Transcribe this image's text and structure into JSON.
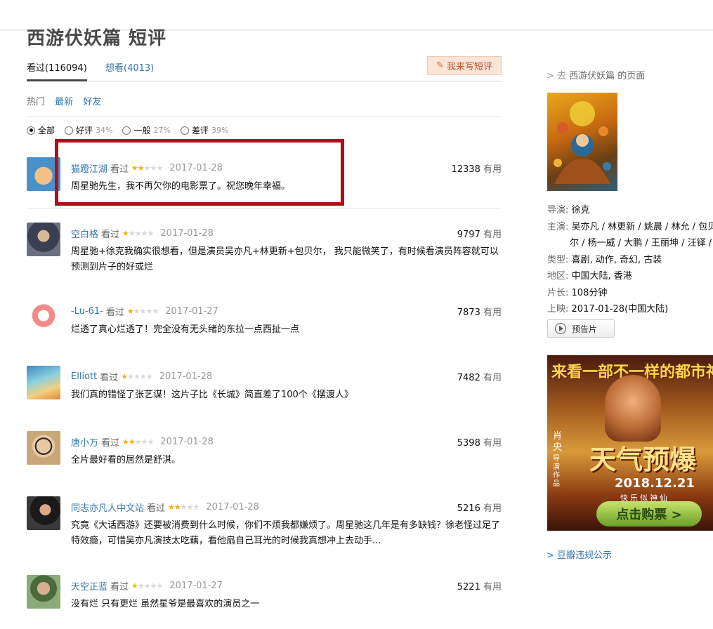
{
  "page_title": "西游伏妖篇 短评",
  "tabs": {
    "watched": "看过(116094)",
    "want": "想看(4013)"
  },
  "write_button": "我来写短评",
  "sort": {
    "hot": "热门",
    "latest": "最新",
    "friends": "好友"
  },
  "filters": [
    {
      "label": "全部",
      "pct": "",
      "selected": true
    },
    {
      "label": "好评",
      "pct": "34%",
      "selected": false
    },
    {
      "label": "一般",
      "pct": "27%",
      "selected": false
    },
    {
      "label": "差评",
      "pct": "39%",
      "selected": false
    }
  ],
  "comments": [
    {
      "user": "猫蹬江湖",
      "saw": "看过",
      "stars": 2,
      "date": "2017-01-28",
      "useful_num": "12338",
      "useful_label": "有用",
      "text": "周星驰先生，我不再欠你的电影票了。祝您晚年幸福。",
      "avatar_color": "#4a90c8"
    },
    {
      "user": "空白格",
      "saw": "看过",
      "stars": 1,
      "date": "2017-01-28",
      "useful_num": "9797",
      "useful_label": "有用",
      "text": "周星驰+徐克我确实很想看，但是演员吴亦凡+林更新+包贝尔， 我只能微笑了，有时候看演员阵容就可以预测到片子的好或烂",
      "avatar_color": "#5a6070"
    },
    {
      "user": "-Lu-61-",
      "saw": "看过",
      "stars": 1,
      "date": "2017-01-27",
      "useful_num": "7873",
      "useful_label": "有用",
      "text": "烂透了真心烂透了！完全没有无头绪的东拉一点西扯一点",
      "avatar_color": "#f2a0a0"
    },
    {
      "user": "Elliott",
      "saw": "看过",
      "stars": 1,
      "date": "2017-01-28",
      "useful_num": "7482",
      "useful_label": "有用",
      "text": "我们真的错怪了张艺谋！这片子比《长城》简直差了100个《摆渡人》",
      "avatar_color": "#7ac0d8"
    },
    {
      "user": "唐小万",
      "saw": "看过",
      "stars": 2,
      "date": "2017-01-28",
      "useful_num": "5398",
      "useful_label": "有用",
      "text": "全片最好看的居然是舒淇。",
      "avatar_color": "#d8b890"
    },
    {
      "user": "同志亦凡人中文站",
      "saw": "看过",
      "stars": 2,
      "date": "2017-01-28",
      "useful_num": "5216",
      "useful_label": "有用",
      "text": "究竟《大话西游》还要被消费到什么时候，你们不烦我都嫌烦了。周星驰这几年是有多缺钱？徐老怪过足了特效瘾，可惜吴亦凡演技太吃藕，看他扇自己耳光的时候我真想冲上去动手...",
      "avatar_color": "#3a3030"
    },
    {
      "user": "天空正蓝",
      "saw": "看过",
      "stars": 1,
      "date": "2017-01-27",
      "useful_num": "5221",
      "useful_label": "有用",
      "text": "没有烂 只有更烂 虽然星爷是最喜欢的演员之一",
      "avatar_color": "#6a8a5a"
    }
  ],
  "sidebar": {
    "goto_prefix": "> 去 ",
    "goto_text": "西游伏妖篇 的页面",
    "info": {
      "director_k": "导演:",
      "director_v": "徐克",
      "cast_k": "主演:",
      "cast_v1": "吴亦凡 / 林更新 / 姚晨 / 林允 / 包贝尔",
      "cast_v2": "尔 / 杨一威 / 大鹏 / 王丽坤 / 汪铎 / 张",
      "genre_k": "类型:",
      "genre_v": "喜剧, 动作, 奇幻, 古装",
      "region_k": "地区:",
      "region_v": "中国大陆, 香港",
      "length_k": "片长:",
      "length_v": "108分钟",
      "release_k": "上映:",
      "release_v": "2017-01-28(中国大陆)"
    },
    "trailer_label": "预告片",
    "ad": {
      "top": "来看一部不一样的都市神仙",
      "title": "天气预爆",
      "date": "2018.12.21",
      "sub": "快乐似神仙",
      "left_name": "肖央",
      "left_role": "导演作品",
      "buy": "点击购票 >"
    },
    "report_link": "> 豆瓣违规公示"
  }
}
